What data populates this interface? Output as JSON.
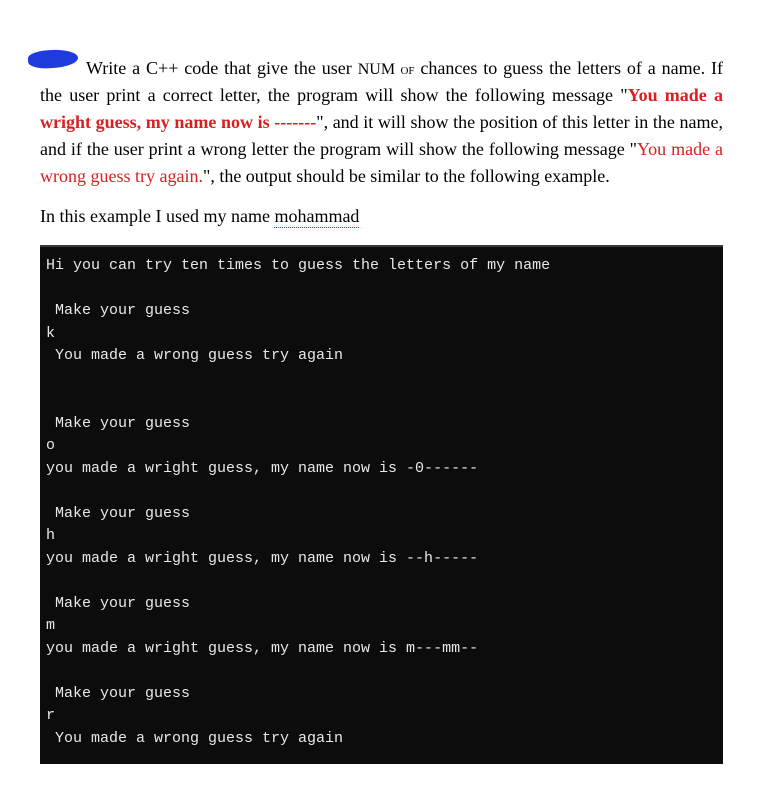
{
  "question": {
    "pre": "Write a C++ code that give the user ",
    "num_text": "NUM of",
    "post_num": " chances to guess the letters of a name. If the user print a correct letter, the program will show the following message \"",
    "msg_correct": "You made a wright guess, my name now is -------",
    "after_correct": "\", and it will show the position of this letter in the name, and if the user print a wrong letter the program will show the following message \"",
    "msg_wrong": "You made a wrong guess try again.",
    "after_wrong": "\", the output should be similar to the following example."
  },
  "example_intro": {
    "pre": "In this example I used my name ",
    "name": "mohammad"
  },
  "terminal_lines": [
    "Hi you can try ten times to guess the letters of my name",
    "",
    " Make your guess",
    "k",
    " You made a wrong guess try again",
    "",
    "",
    " Make your guess",
    "o",
    "you made a wright guess, my name now is -0------",
    "",
    " Make your guess",
    "h",
    "you made a wright guess, my name now is --h-----",
    "",
    " Make your guess",
    "m",
    "you made a wright guess, my name now is m---mm--",
    "",
    " Make your guess",
    "r",
    " You made a wrong guess try again"
  ]
}
